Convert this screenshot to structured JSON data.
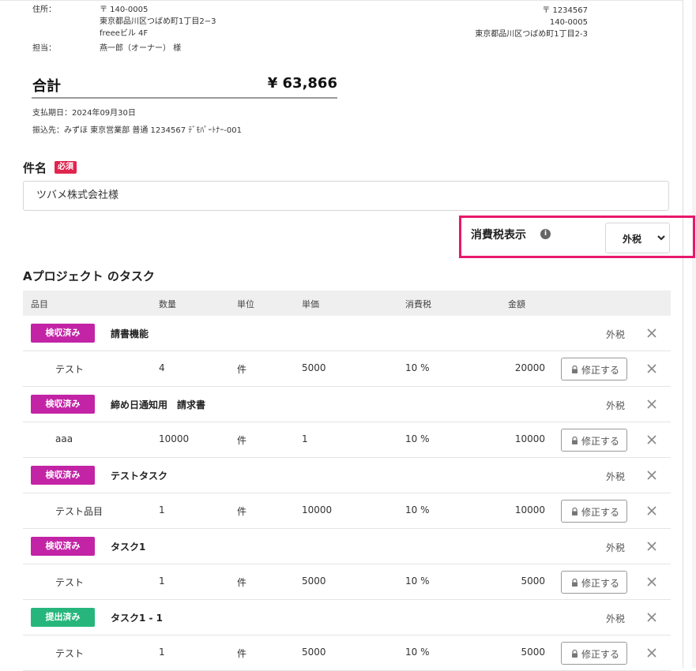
{
  "header": {
    "address_label": "住所：",
    "address_lines": [
      "〒 140-0005",
      "東京都品川区つばめ町1丁目2−3",
      "freeeビル 4F"
    ],
    "contact_label": "担当：",
    "contact_value": "燕一郎（オーナー） 様",
    "recipient_lines": [
      "〒 1234567",
      "140-0005",
      "東京都品川区つばめ町1丁目2-3"
    ]
  },
  "summary": {
    "total_label": "合計",
    "total_value": "¥ 63,866",
    "due_date": "支払期日：2024年09月30日",
    "bank": "振込先：みずほ 東京営業部 普通 1234567 ﾃﾞﾓﾊﾟｰﾄﾅｰ-001"
  },
  "subject": {
    "label": "件名",
    "required_badge": "必須",
    "value": "ツバメ株式会社様"
  },
  "tax_display": {
    "label": "消費税表示",
    "info_icon": "i",
    "selected": "外税"
  },
  "section_title": "Aプロジェクト のタスク",
  "columns": [
    "品目",
    "数量",
    "単位",
    "単価",
    "消費税",
    "金額"
  ],
  "tasks": [
    {
      "status": "検収済み",
      "status_kind": "done",
      "name": "請書機能",
      "tax": "外税",
      "item": {
        "name": "テスト",
        "qty": "4",
        "unit": "件",
        "price": "5000",
        "tax": "10 %",
        "amount": "20000",
        "edit": "修正する"
      }
    },
    {
      "status": "検収済み",
      "status_kind": "done",
      "name": "締め日通知用　請求書",
      "tax": "外税",
      "item": {
        "name": "aaa",
        "qty": "10000",
        "unit": "件",
        "price": "1",
        "tax": "10 %",
        "amount": "10000",
        "edit": "修正する"
      }
    },
    {
      "status": "検収済み",
      "status_kind": "done",
      "name": "テストタスク",
      "tax": "外税",
      "item": {
        "name": "テスト品目",
        "qty": "1",
        "unit": "件",
        "price": "10000",
        "tax": "10 %",
        "amount": "10000",
        "edit": "修正する"
      }
    },
    {
      "status": "検収済み",
      "status_kind": "done",
      "name": "タスク1",
      "tax": "外税",
      "item": {
        "name": "テスト",
        "qty": "1",
        "unit": "件",
        "price": "5000",
        "tax": "10 %",
        "amount": "5000",
        "edit": "修正する"
      }
    },
    {
      "status": "提出済み",
      "status_kind": "submitted",
      "name": "タスク1 - 1",
      "tax": "外税",
      "item": {
        "name": "テスト",
        "qty": "1",
        "unit": "件",
        "price": "5000",
        "tax": "10 %",
        "amount": "5000",
        "edit": "修正する"
      }
    }
  ],
  "colors": {
    "highlight": "#e8186c",
    "status_done": "#c224a5",
    "status_submitted": "#26b67c",
    "required": "#e0264f"
  }
}
